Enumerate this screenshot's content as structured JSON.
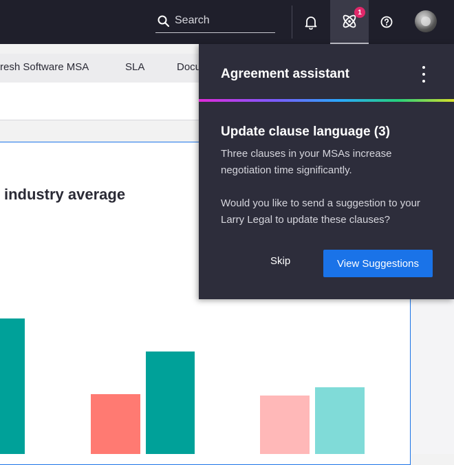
{
  "topbar": {
    "search_placeholder": "Search",
    "assistant_badge": "1"
  },
  "tabs": [
    "resh Software MSA",
    "SLA",
    "Docu"
  ],
  "main": {
    "headline": "industry average"
  },
  "chart_data": {
    "type": "bar",
    "bars_visible": [
      {
        "color": "#00a199"
      },
      {
        "color": "#ff7a72"
      },
      {
        "color": "#00a199"
      },
      {
        "color": "#ffb8b8"
      },
      {
        "color": "#80dbd8"
      }
    ]
  },
  "panel": {
    "title": "Agreement assistant",
    "section_title": "Update clause language (3)",
    "para1": "Three clauses in your MSAs increase negotiation time significantly.",
    "para2": "Would you like to send a suggestion to your Larry Legal to update these clauses?",
    "skip_label": "Skip",
    "view_label": "View Suggestions"
  },
  "colors": {
    "topbar": "#1f1f2b",
    "panel": "#2d2d3b",
    "primary": "#1a73e8",
    "badge": "#e0286a"
  }
}
